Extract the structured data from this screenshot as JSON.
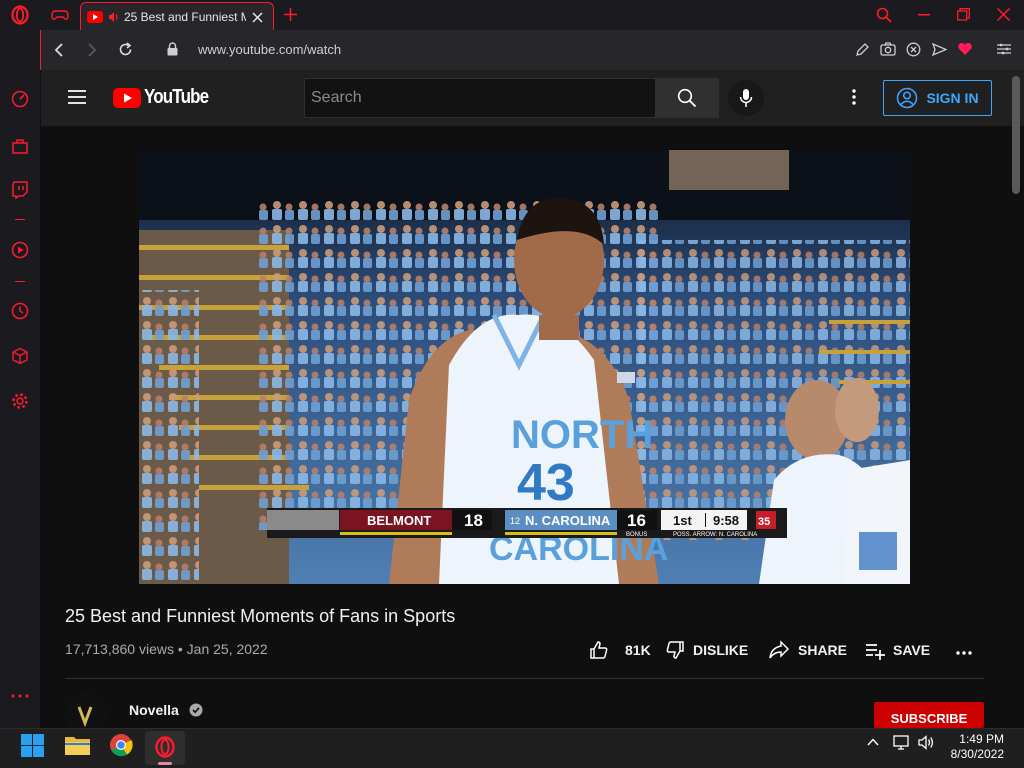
{
  "browser": {
    "tab": {
      "title": "25 Best and Funniest M",
      "icon": "youtube-icon",
      "audio_icon": "speaker-icon"
    },
    "address": {
      "url": "www.youtube.com/watch"
    },
    "accent": "#ff1b2d"
  },
  "youtube": {
    "logo_text": "YouTube",
    "search": {
      "placeholder": "Search"
    },
    "signin_label": "SIGN IN"
  },
  "video": {
    "scoreboard": {
      "away_team": "BELMONT",
      "away_score": "18",
      "home_rank": "12",
      "home_team": "N. CAROLINA",
      "home_score": "16",
      "bonus_label": "BONUS",
      "period": "1st",
      "clock": "9:58",
      "shot_clock": "35",
      "possession": "POSS. ARROW: N. CAROLINA"
    },
    "jersey": {
      "text": "NORTH",
      "number": "43",
      "lower": "CAROLINA"
    }
  },
  "watch": {
    "title": "25 Best and Funniest Moments of Fans in Sports",
    "views": "17,713,860 views",
    "separator": "•",
    "date": "Jan 25, 2022",
    "actions": {
      "like_count": "81K",
      "dislike_label": "DISLIKE",
      "share_label": "SHARE",
      "save_label": "SAVE"
    },
    "channel": {
      "name": "Novella",
      "verified_icon": "verified-check-icon"
    },
    "subscribe_label": "SUBSCRIBE"
  },
  "taskbar": {
    "time": "1:49 PM",
    "date": "8/30/2022"
  },
  "colors": {
    "yt_red": "#ff0000",
    "link_blue": "#3ea6ff",
    "subscribe_red": "#cc0000"
  }
}
